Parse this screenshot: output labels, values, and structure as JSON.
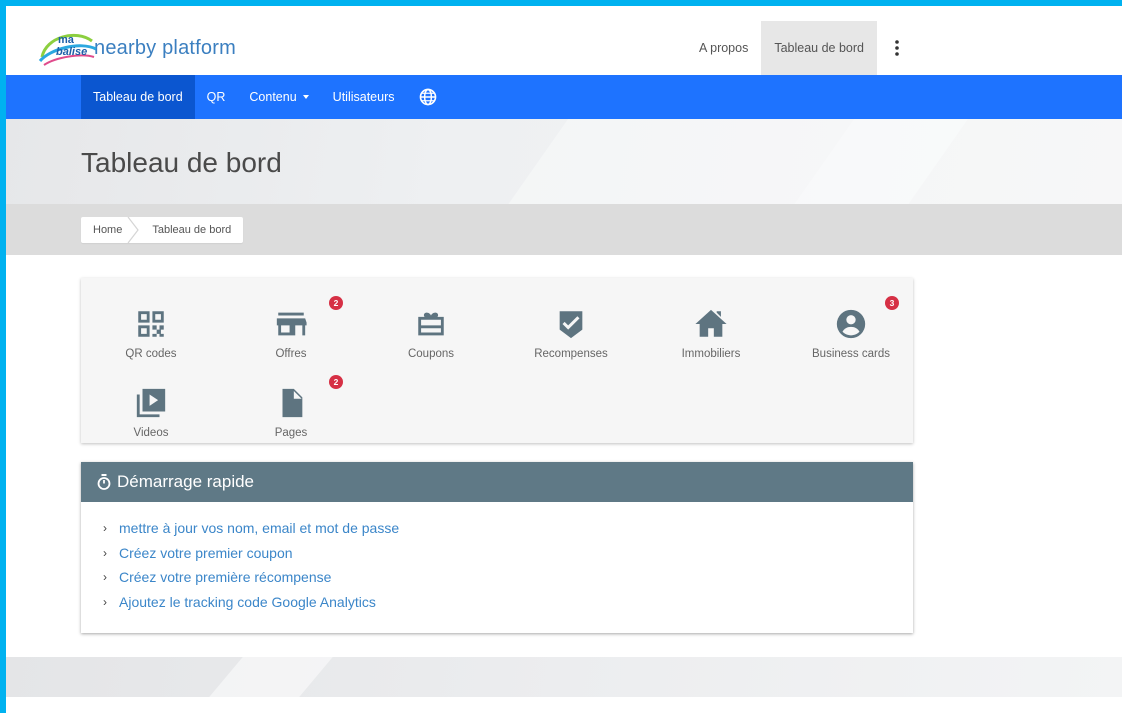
{
  "brand": {
    "mark_text_1": "ma",
    "mark_text_2": "balise",
    "name": "nearby platform"
  },
  "topnav": {
    "about": "A propos",
    "dashboard": "Tableau de bord"
  },
  "mainnav": {
    "dashboard": "Tableau de bord",
    "qr": "QR",
    "content": "Contenu",
    "users": "Utilisateurs"
  },
  "page": {
    "title": "Tableau de bord"
  },
  "breadcrumb": {
    "home": "Home",
    "current": "Tableau de bord"
  },
  "shortcuts": [
    {
      "label": "QR codes",
      "icon": "qr-code-icon",
      "badge": ""
    },
    {
      "label": "Offres",
      "icon": "store-icon",
      "badge": "2"
    },
    {
      "label": "Coupons",
      "icon": "gift-coupon-icon",
      "badge": ""
    },
    {
      "label": "Recompenses",
      "icon": "reward-check-icon",
      "badge": ""
    },
    {
      "label": "Immobiliers",
      "icon": "house-icon",
      "badge": ""
    },
    {
      "label": "Business cards",
      "icon": "account-circle-icon",
      "badge": "3"
    },
    {
      "label": "Videos",
      "icon": "video-library-icon",
      "badge": ""
    },
    {
      "label": "Pages",
      "icon": "document-icon",
      "badge": "2"
    }
  ],
  "quickstart": {
    "title": "Démarrage rapide",
    "items": [
      "mettre à jour vos nom, email et mot de passe",
      "Créez votre premier coupon",
      "Créez votre première récompense",
      "Ajoutez le tracking code Google Analytics"
    ]
  },
  "colors": {
    "nav_blue": "#1e73ff",
    "nav_active": "#0b56d0",
    "panel_head": "#5f7986",
    "badge": "#d63045",
    "link": "#3b86c9",
    "icon": "#5e7480"
  }
}
